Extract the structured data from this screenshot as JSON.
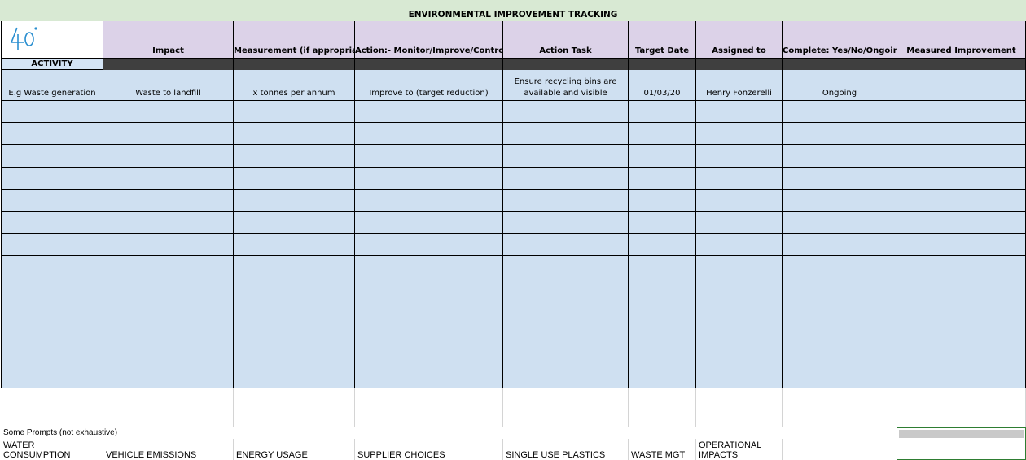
{
  "title": "ENVIRONMENTAL IMPROVEMENT TRACKING",
  "logo_text": "40",
  "activity_label": "ACTIVITY",
  "headers": [
    "Impact",
    "Measurement (if appropriate)",
    "Action:- Monitor/Improve/Control",
    "Action Task",
    "Target Date",
    "Assigned to",
    "Complete: Yes/No/Ongoing",
    "Measured Improvement"
  ],
  "example_row": [
    "E.g Waste generation",
    "Waste to landfill",
    "x tonnes per annum",
    "Improve to (target reduction)",
    "Ensure recycling bins are available and visible",
    "01/03/20",
    "Henry Fonzerelli",
    "Ongoing",
    ""
  ],
  "prompts_label": "Some Prompts (not exhaustive)",
  "prompts": [
    "WATER CONSUMPTION",
    "VEHICLE EMISSIONS",
    "ENERGY USAGE",
    "SUPPLIER CHOICES",
    "SINGLE USE PLASTICS",
    "WASTE MGT",
    "OPERATIONAL IMPACTS",
    "",
    ""
  ],
  "colors": {
    "title_bg": "#d8e9d3",
    "header_bg": "#dcd2e8",
    "cell_bg": "#cfe0f1",
    "dark_band": "#3f3f3f",
    "logo_blue": "#2b8fd0"
  }
}
